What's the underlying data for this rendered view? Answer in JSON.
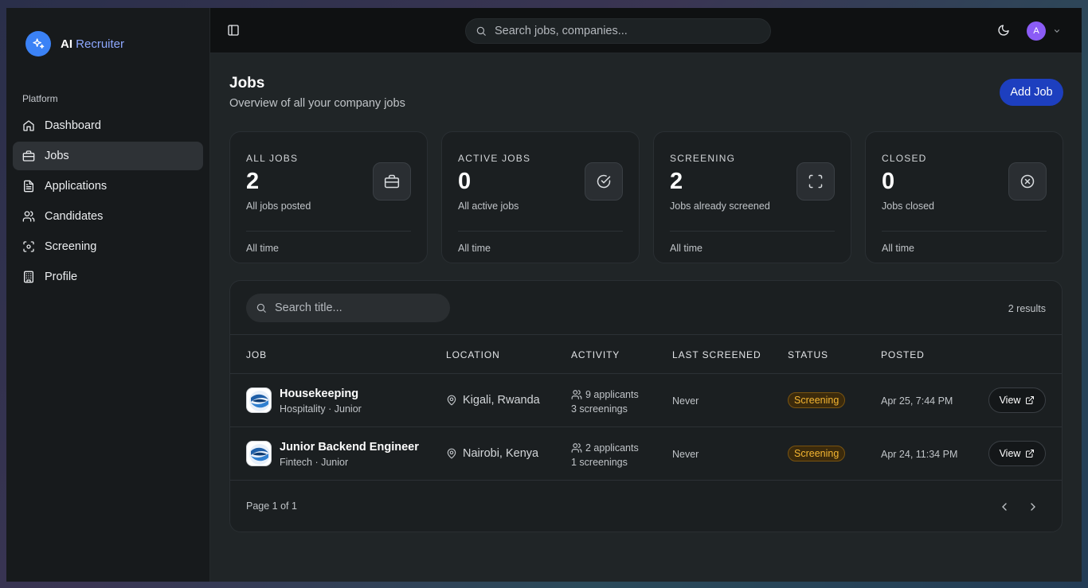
{
  "brand": {
    "name_bold": "AI",
    "name_light": "Recruiter",
    "icon": "sparkles-icon"
  },
  "sidebar": {
    "section_label": "Platform",
    "items": [
      {
        "label": "Dashboard",
        "icon": "home-icon"
      },
      {
        "label": "Jobs",
        "icon": "briefcase-icon",
        "active": true
      },
      {
        "label": "Applications",
        "icon": "file-text-icon"
      },
      {
        "label": "Candidates",
        "icon": "users-icon"
      },
      {
        "label": "Screening",
        "icon": "scan-icon"
      },
      {
        "label": "Profile",
        "icon": "building-icon"
      }
    ]
  },
  "topbar": {
    "search_placeholder": "Search jobs, companies...",
    "avatar_initial": "A"
  },
  "page": {
    "title": "Jobs",
    "subtitle": "Overview of all your company jobs",
    "add_button": "Add Job"
  },
  "stats": [
    {
      "label": "ALL JOBS",
      "value": "2",
      "desc": "All jobs posted",
      "footer": "All time",
      "icon": "briefcase-icon"
    },
    {
      "label": "ACTIVE JOBS",
      "value": "0",
      "desc": "All active jobs",
      "footer": "All time",
      "icon": "check-circle-icon"
    },
    {
      "label": "SCREENING",
      "value": "2",
      "desc": "Jobs already screened",
      "footer": "All time",
      "icon": "scan-icon"
    },
    {
      "label": "CLOSED",
      "value": "0",
      "desc": "Jobs closed",
      "footer": "All time",
      "icon": "x-circle-icon"
    }
  ],
  "table": {
    "search_placeholder": "Search title...",
    "result_count": "2 results",
    "columns": [
      "JOB",
      "LOCATION",
      "ACTIVITY",
      "LAST SCREENED",
      "STATUS",
      "POSTED"
    ],
    "rows": [
      {
        "title": "Housekeeping",
        "subtitle": "Hospitality · Junior",
        "location": "Kigali, Rwanda",
        "applicants": "9 applicants",
        "screenings": "3 screenings",
        "last_screened": "Never",
        "status": "Screening",
        "posted": "Apr 25, 7:44 PM",
        "action": "View"
      },
      {
        "title": "Junior Backend Engineer",
        "subtitle": "Fintech · Junior",
        "location": "Nairobi, Kenya",
        "applicants": "2 applicants",
        "screenings": "1 screenings",
        "last_screened": "Never",
        "status": "Screening",
        "posted": "Apr 24, 11:34 PM",
        "action": "View"
      }
    ],
    "pagination": "Page 1 of 1"
  },
  "colors": {
    "accent": "#1d3fbf",
    "brand": "#3b82f6",
    "avatar": "#8b5cf6",
    "status_screening": "#f5b632"
  }
}
